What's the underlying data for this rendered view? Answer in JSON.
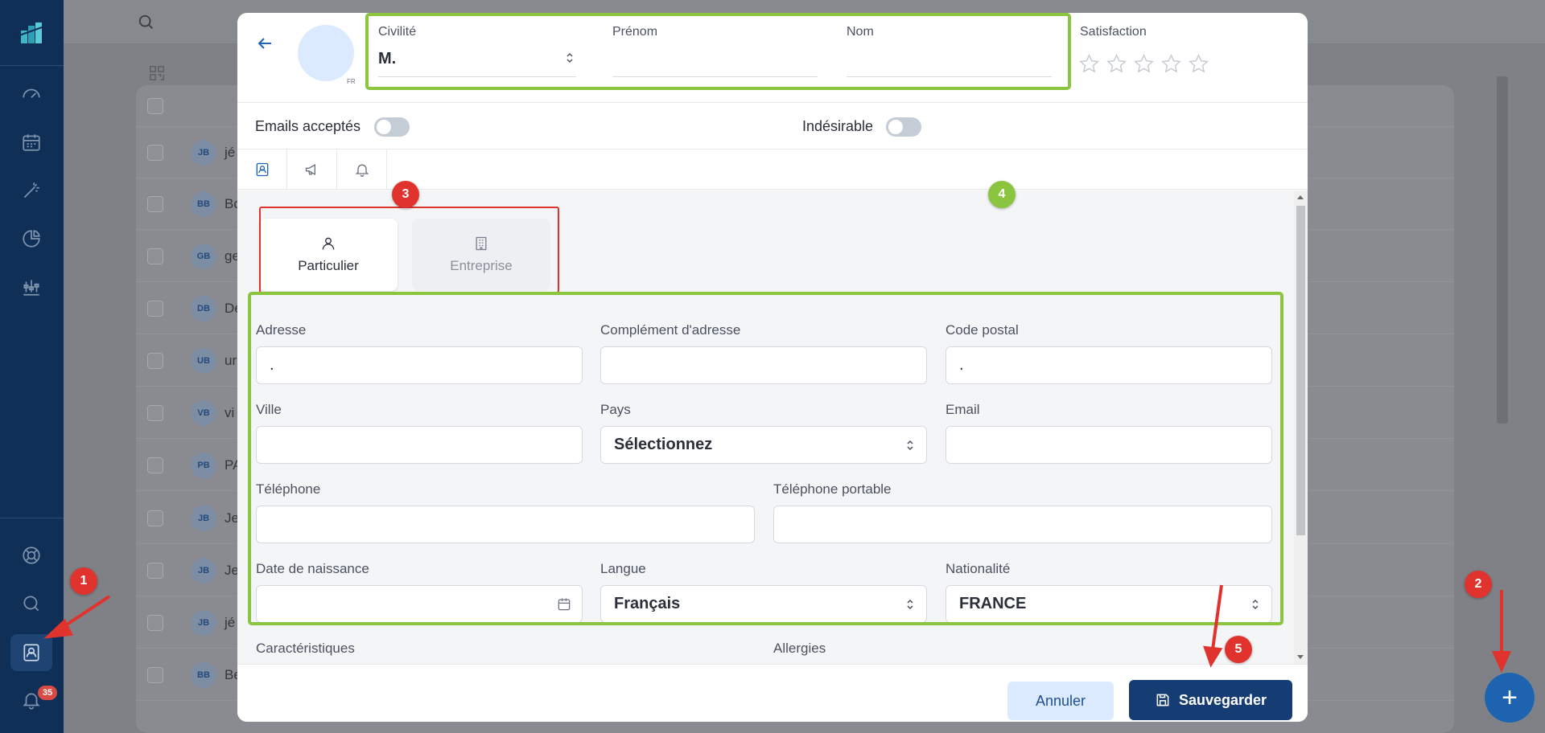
{
  "sidebar": {
    "notification_count": "35",
    "items": [
      {
        "name": "dashboard"
      },
      {
        "name": "calendar"
      },
      {
        "name": "magic"
      },
      {
        "name": "statistics"
      },
      {
        "name": "settings"
      }
    ]
  },
  "background_list": {
    "rows": [
      {
        "initials": "JB",
        "name": "jé"
      },
      {
        "initials": "BB",
        "name": "Bo"
      },
      {
        "initials": "GB",
        "name": "ge"
      },
      {
        "initials": "DB",
        "name": "De"
      },
      {
        "initials": "UB",
        "name": "ur"
      },
      {
        "initials": "VB",
        "name": "vi"
      },
      {
        "initials": "PB",
        "name": "PA"
      },
      {
        "initials": "JB",
        "name": "Je"
      },
      {
        "initials": "JB",
        "name": "Je"
      },
      {
        "initials": "JB",
        "name": "jé"
      },
      {
        "initials": "BB",
        "name": "Be"
      }
    ]
  },
  "header": {
    "flag_label": "FR",
    "civilite": {
      "label": "Civilité",
      "value": "M."
    },
    "prenom": {
      "label": "Prénom",
      "value": ""
    },
    "nom": {
      "label": "Nom",
      "value": ""
    },
    "satisfaction": {
      "label": "Satisfaction",
      "rating": 0,
      "max": 5
    }
  },
  "toggles": {
    "emails": {
      "label": "Emails acceptés",
      "on": false
    },
    "indesirable": {
      "label": "Indésirable",
      "on": false
    }
  },
  "tabs": [
    {
      "icon": "contact-card-icon",
      "active": true
    },
    {
      "icon": "megaphone-icon",
      "active": false
    },
    {
      "icon": "bell-icon",
      "active": false
    }
  ],
  "type_selector": {
    "particulier": "Particulier",
    "entreprise": "Entreprise",
    "selected": "Particulier"
  },
  "form": {
    "adresse": {
      "label": "Adresse",
      "value": "."
    },
    "complement": {
      "label": "Complément d'adresse",
      "value": ""
    },
    "code_postal": {
      "label": "Code postal",
      "value": "."
    },
    "ville": {
      "label": "Ville",
      "value": ""
    },
    "pays": {
      "label": "Pays",
      "value": "Sélectionnez"
    },
    "email": {
      "label": "Email",
      "value": ""
    },
    "telephone": {
      "label": "Téléphone",
      "value": ""
    },
    "telephone_portable": {
      "label": "Téléphone portable",
      "value": ""
    },
    "date_naissance": {
      "label": "Date de naissance",
      "value": ""
    },
    "langue": {
      "label": "Langue",
      "value": "Français"
    },
    "nationalite": {
      "label": "Nationalité",
      "value": "FRANCE"
    },
    "caracteristiques": {
      "label": "Caractéristiques"
    },
    "allergies": {
      "label": "Allergies"
    }
  },
  "footer": {
    "cancel_label": "Annuler",
    "save_label": "Sauvegarder"
  },
  "annotations": {
    "markers": [
      "1",
      "2",
      "3",
      "4",
      "5"
    ],
    "colors": {
      "red": "#e0332d",
      "green": "#8bc53f"
    }
  },
  "colors": {
    "sidebar": "#0f2f57",
    "primary": "#163d73",
    "fab": "#1e63b0",
    "avatar": "#dbeafe"
  }
}
